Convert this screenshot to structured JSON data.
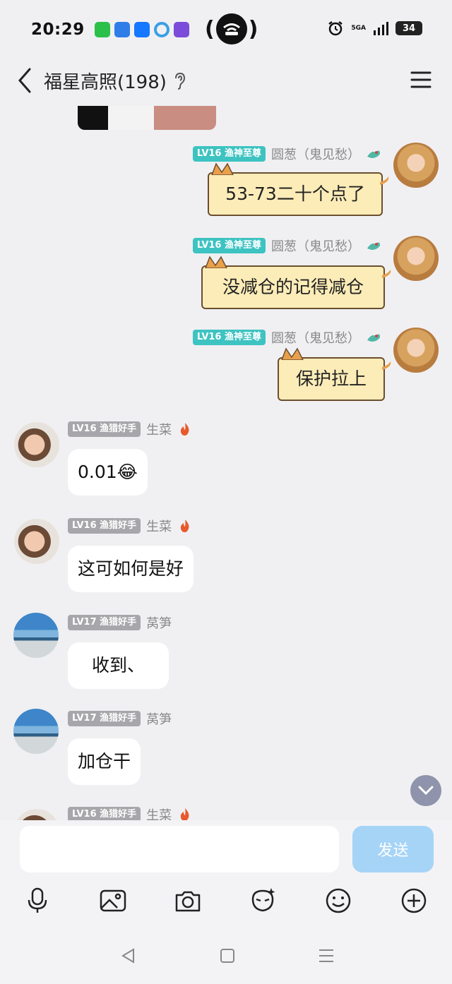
{
  "status_bar": {
    "time": "20:29",
    "hotspot_open": "(",
    "hotspot_close": ")",
    "network_label": "5GA",
    "battery_level": "34"
  },
  "header": {
    "title": "福星高照(198)"
  },
  "messages": [
    {
      "side": "right",
      "level": "LV16 渔神至尊",
      "nick": "圆葱（鬼见愁）",
      "text": "53-73二十个点了"
    },
    {
      "side": "right",
      "level": "LV16 渔神至尊",
      "nick": "圆葱（鬼见愁）",
      "text": "没减仓的记得减仓"
    },
    {
      "side": "right",
      "level": "LV16 渔神至尊",
      "nick": "圆葱（鬼见愁）",
      "text": "保护拉上"
    },
    {
      "side": "left",
      "level": "LV16 渔猎好手",
      "nick": "生菜",
      "text": "0.01😂"
    },
    {
      "side": "left",
      "level": "LV16 渔猎好手",
      "nick": "生菜",
      "text": "这可如何是好"
    },
    {
      "side": "left",
      "level": "LV17 渔猎好手",
      "nick": "莴笋",
      "text": "收到、"
    },
    {
      "side": "left",
      "level": "LV17 渔猎好手",
      "nick": "莴笋",
      "text": "加仓干"
    },
    {
      "side": "left",
      "level": "LV16 渔猎好手",
      "nick": "生菜",
      "text": ""
    }
  ],
  "composer": {
    "placeholder": "",
    "send_label": "发送"
  },
  "colors": {
    "accent_teal": "#3dc3c1",
    "send_button": "#a6d4f7",
    "cat_bubble": "#fcecb8"
  },
  "icons": {
    "toolbar": [
      "microphone-icon",
      "image-icon",
      "camera-icon",
      "sticker-icon",
      "emoji-icon",
      "plus-icon"
    ],
    "nav": [
      "back-triangle-icon",
      "home-square-icon",
      "recents-lines-icon"
    ]
  }
}
